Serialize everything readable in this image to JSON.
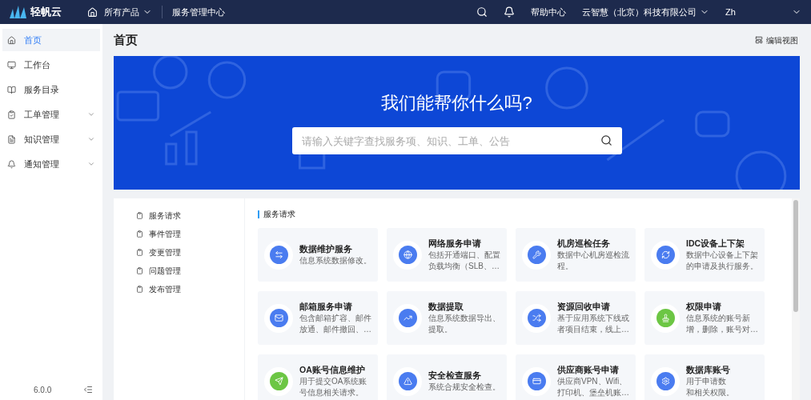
{
  "header": {
    "logo": "轻帆云",
    "products": "所有产品",
    "center": "服务管理中心",
    "help": "帮助中心",
    "company": "云智慧（北京）科技有限公司",
    "user": "Zh"
  },
  "sidebar": {
    "items": [
      {
        "label": "首页",
        "selected": true,
        "expandable": false
      },
      {
        "label": "工作台",
        "selected": false,
        "expandable": false
      },
      {
        "label": "服务目录",
        "selected": false,
        "expandable": false
      },
      {
        "label": "工单管理",
        "selected": false,
        "expandable": true
      },
      {
        "label": "知识管理",
        "selected": false,
        "expandable": true
      },
      {
        "label": "通知管理",
        "selected": false,
        "expandable": true
      }
    ],
    "version": "6.0.0"
  },
  "page": {
    "title": "首页",
    "edit_view": "编辑视图"
  },
  "banner": {
    "heading": "我们能帮你什么吗?",
    "search_placeholder": "请输入关键字查找服务项、知识、工单、公告"
  },
  "catalog": {
    "categories": [
      "服务请求",
      "事件管理",
      "变更管理",
      "问题管理",
      "发布管理"
    ],
    "section_title": "服务请求",
    "cards": [
      {
        "title": "数据维护服务",
        "desc": [
          "信息系统数据修改。"
        ],
        "color": "#4a7cf0"
      },
      {
        "title": "网络服务申请",
        "desc": [
          "包括开通端口、配置",
          "负载均衡（SLB、…"
        ],
        "color": "#4a7cf0"
      },
      {
        "title": "机房巡检任务",
        "desc": [
          "数据中心机房巡检流",
          "程。"
        ],
        "color": "#4a7cf0"
      },
      {
        "title": "IDC设备上下架",
        "desc": [
          "数据中心设备上下架",
          "的申请及执行服务。"
        ],
        "color": "#4a7cf0"
      },
      {
        "title": "邮箱服务申请",
        "desc": [
          "包含邮箱扩容、邮件",
          "放通、邮件撤回、…"
        ],
        "color": "#4a7cf0"
      },
      {
        "title": "数据提取",
        "desc": [
          "信息系统数据导出、",
          "提取。"
        ],
        "color": "#4a7cf0"
      },
      {
        "title": "资源回收申请",
        "desc": [
          "基于应用系统下线或",
          "者项目结束，线上…"
        ],
        "color": "#4a7cf0"
      },
      {
        "title": "权限申请",
        "desc": [
          "信息系统的账号新",
          "增，删除，账号对…"
        ],
        "color": "#6cc644"
      },
      {
        "title": "OA账号信息维护",
        "desc": [
          "用于提交OA系统账",
          "号信息相关请求。"
        ],
        "color": "#6cc644"
      },
      {
        "title": "安全检查服务",
        "desc": [
          "系统合规安全检查。"
        ],
        "color": "#4a7cf0"
      },
      {
        "title": "供应商账号申请",
        "desc": [
          "供应商VPN、Wifi、",
          "打印机、堡垒机账…"
        ],
        "color": "#4a7cf0"
      },
      {
        "title": "数据库账号",
        "desc": [
          "用于申请数",
          "和相关权限。"
        ],
        "color": "#4a7cf0"
      }
    ]
  }
}
